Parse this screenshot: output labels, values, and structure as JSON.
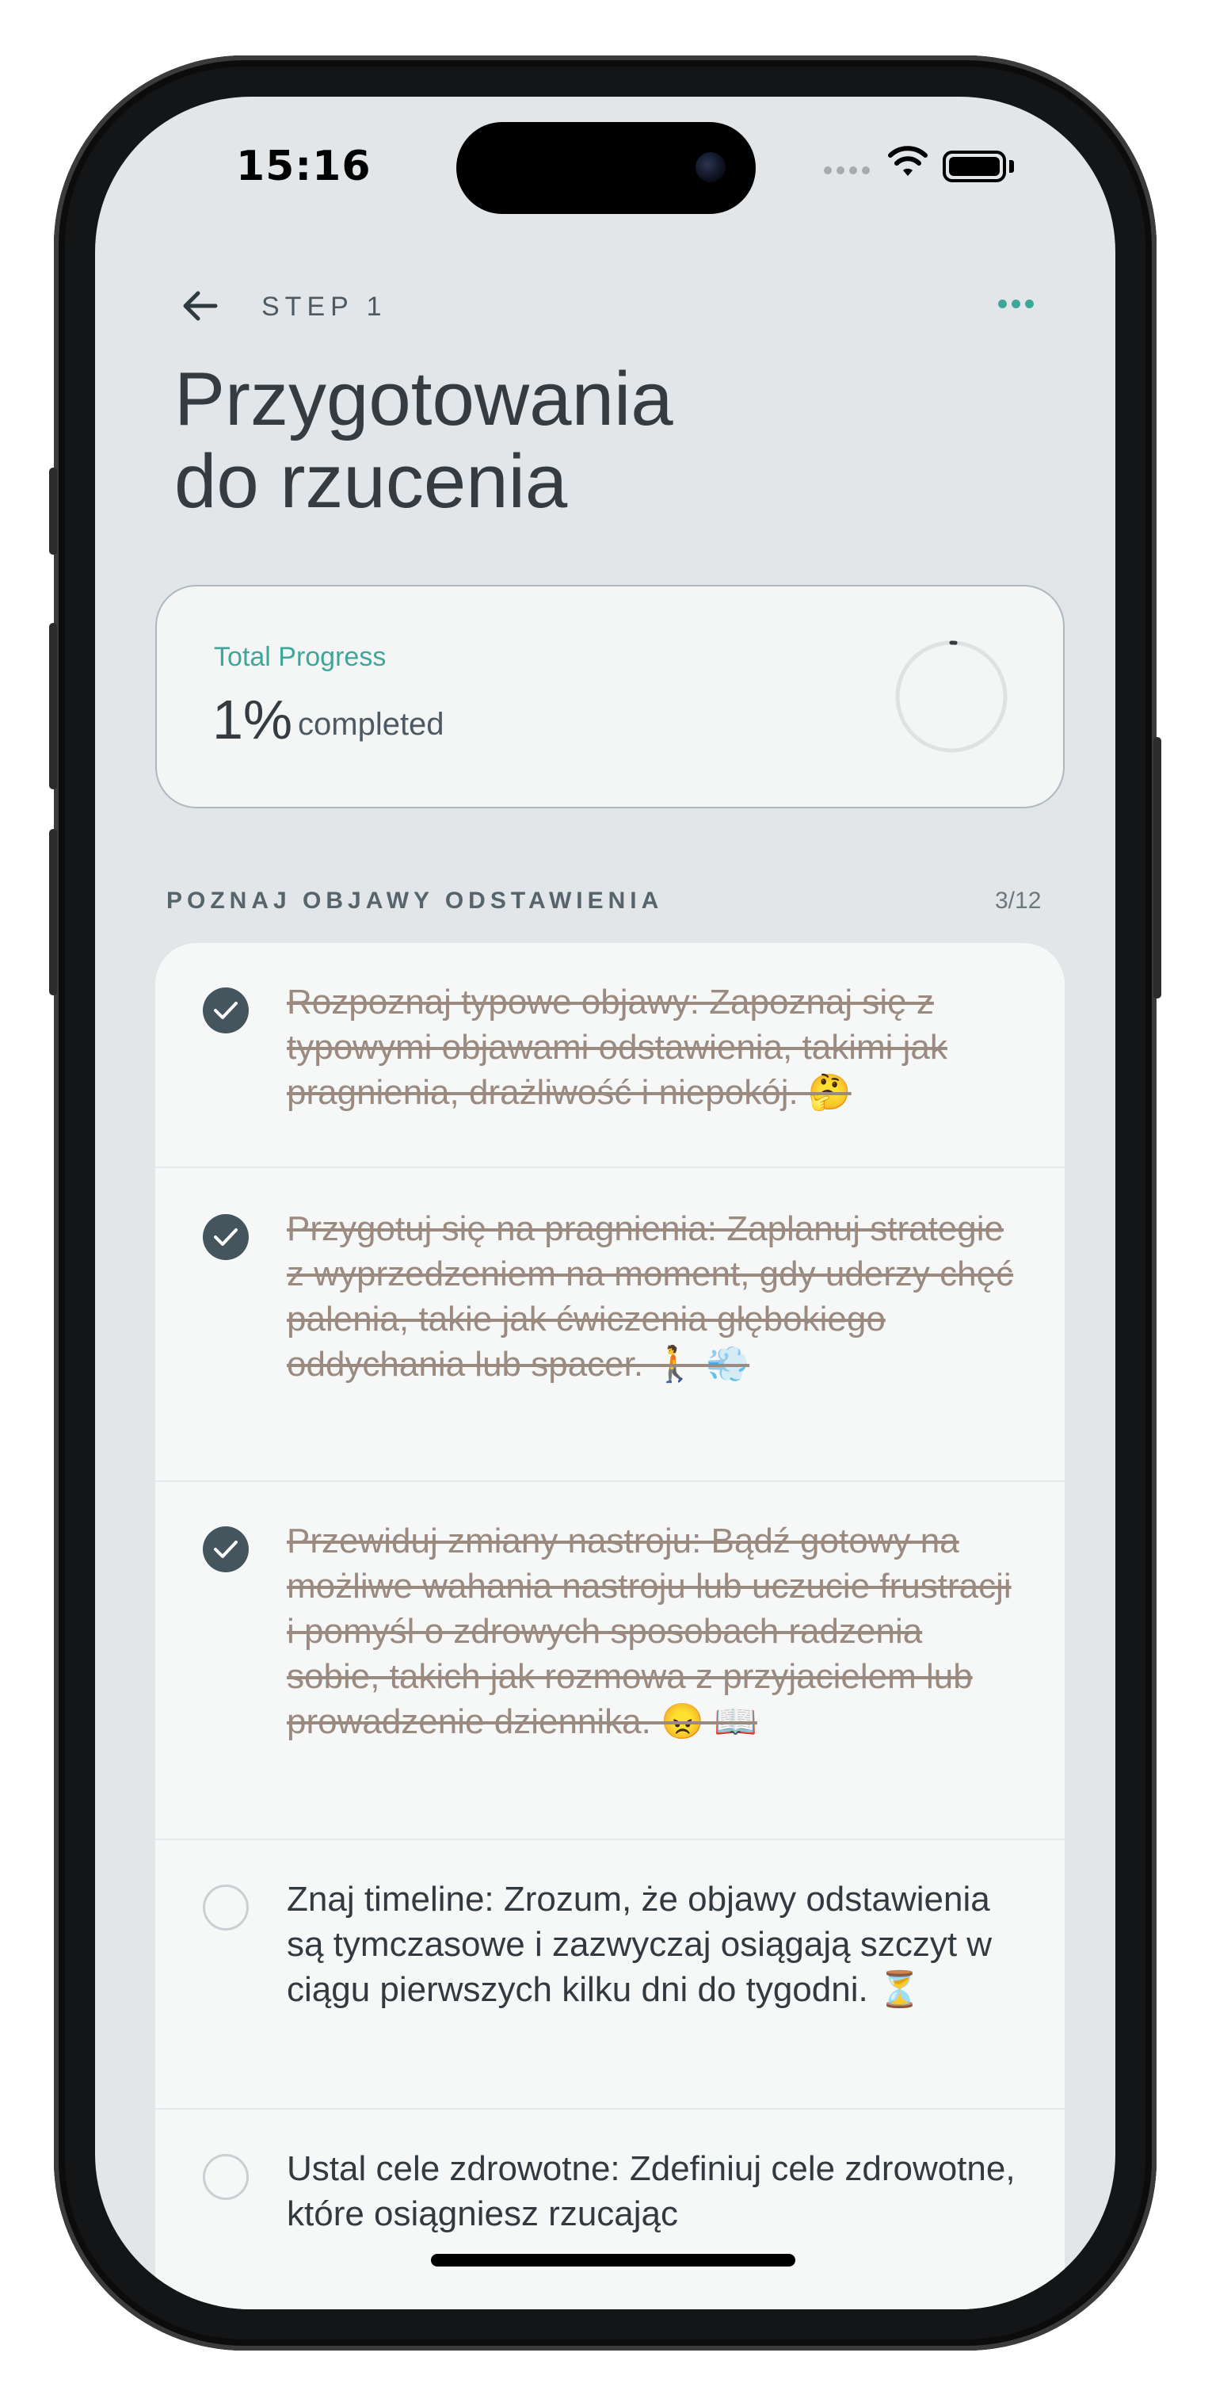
{
  "status_bar": {
    "time": "15:16"
  },
  "header": {
    "step_label": "STEP 1",
    "title_line1": "Przygotowania",
    "title_line2": "do rzucenia"
  },
  "progress": {
    "label": "Total Progress",
    "value": "1%",
    "suffix": "completed",
    "fraction": 0.01,
    "accent_color": "#3fa79a"
  },
  "section": {
    "title": "POZNAJ OBJAWY ODSTAWIENIA",
    "count": "3/12"
  },
  "tasks": [
    {
      "done": true,
      "text": "Rozpoznaj typowe objawy: Zapoznaj się z typowymi objawami odstawienia, takimi jak pragnienia, drażliwość i niepokój. 🤔"
    },
    {
      "done": true,
      "text": "Przygotuj się na pragnienia: Zaplanuj strategie z wyprzedzeniem na moment, gdy uderzy chęć palenia, takie jak ćwiczenia głębokiego oddychania lub spacer. 🚶 💨"
    },
    {
      "done": true,
      "text": "Przewiduj zmiany nastroju: Bądź gotowy na możliwe wahania nastroju lub uczucie frustracji i pomyśl o zdrowych sposobach radzenia sobie, takich jak rozmowa z przyjacielem lub prowadzenie dziennika. 😠 📖"
    },
    {
      "done": false,
      "text": "Znaj timeline: Zrozum, że objawy odstawienia są tymczasowe i zazwyczaj osiągają szczyt w ciągu pierwszych kilku dni do tygodni. ⏳"
    },
    {
      "done": false,
      "text": "Ustal cele zdrowotne: Zdefiniuj cele zdrowotne, które osiągniesz rzucając"
    }
  ],
  "icons": {
    "back": "arrow-left-icon",
    "more": "more-dots-icon",
    "check": "checkmark-icon",
    "wifi": "wifi-icon",
    "battery": "battery-icon"
  }
}
